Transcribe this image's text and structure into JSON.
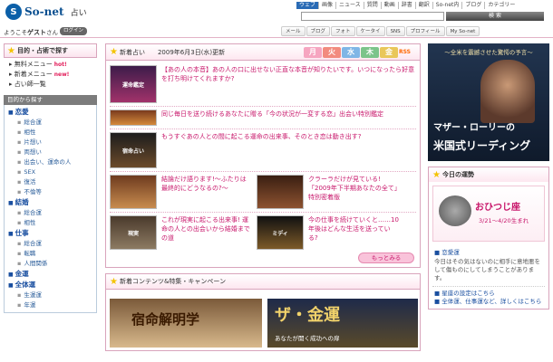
{
  "header": {
    "logo_mark": "S",
    "logo_name": "So-net",
    "logo_sub": "占い",
    "top_links": [
      "ウェブ",
      "画像",
      "ニュース",
      "質問",
      "動画",
      "辞書",
      "翻訳",
      "So-net内",
      "ブログ",
      "カテゴリー"
    ],
    "search_button": "検 索"
  },
  "userbar": {
    "welcome_prefix": "ようこそ",
    "welcome_guest": "ゲスト",
    "welcome_suffix": "さん",
    "login_label": "ログイン",
    "service_tabs": [
      "メール",
      "ブログ",
      "フォト",
      "ケータイ",
      "SNS",
      "プロフィール",
      "My So-net"
    ]
  },
  "sidebar": {
    "head_label": "目的・占術で探す",
    "menu": [
      {
        "label": "無料メニュー",
        "badge": "hot!"
      },
      {
        "label": "新着メニュー",
        "badge": "new!"
      },
      {
        "label": "占い師一覧",
        "badge": ""
      }
    ],
    "category_bar": "目的から探す",
    "groups": [
      {
        "title": "恋愛",
        "items": [
          "総合運",
          "相性",
          "片想い",
          "両想い",
          "出会い、運命の人",
          "SEX",
          "復活",
          "不倫等"
        ]
      },
      {
        "title": "結婚",
        "items": [
          "総合運",
          "相性"
        ]
      },
      {
        "title": "仕事",
        "items": [
          "総合運",
          "転職",
          "人間関係"
        ]
      },
      {
        "title": "金運",
        "items": []
      },
      {
        "title": "全体運",
        "items": [
          "生運運",
          "年運"
        ]
      }
    ]
  },
  "news": {
    "head_label": "新着占い",
    "date": "2009年6月3日(水)更新",
    "days": [
      "月",
      "火",
      "水",
      "木",
      "金"
    ],
    "rss": "RSS",
    "items": [
      {
        "thumb": "運命鑑定",
        "text": "【あの人の本音】あの人の口に出せない正直な本音が知りたいです。いつになったら好意を打ち明けてくれますか?"
      },
      {
        "thumb": "",
        "text": "同じ毎日を送り続けるあなたに贈る「今の状況が一変する恋」出会い特別鑑定"
      },
      {
        "thumb": "宿命占い",
        "text": "もうすぐあの人との間に起こる運命の出来事、そのとき恋は動き出す?"
      },
      {
        "thumb": "",
        "text": "結論だけ語ります!〜ふたりは最終的にどうなるの?〜"
      },
      {
        "thumb": "",
        "text": "クラーラだけが見ている!「2009年下半期あなたの全て」特別密着版"
      },
      {
        "thumb": "現実",
        "text": "これが現実に起こる出来事! 運命の人との出会いから結婚までの道"
      },
      {
        "thumb": "ミディ",
        "text": "今の仕事を続けていくと……10年後はどんな生活を送っている?"
      }
    ],
    "more_label": "もっとみる"
  },
  "contents": {
    "head_label": "新着コンテンツ&特集・キャンペーン",
    "banner1_text": "宿命解明学",
    "banner2_text": "ザ・金運",
    "banner2_sub": "あなたが開く成功への扉"
  },
  "right": {
    "ad_caption": "〜全米を震撼させた驚愕の予言〜",
    "ad_title1": "マザー・ローリーの",
    "ad_title2": "米国式リーディング",
    "fortune_head": "今日の運勢",
    "sign_name": "おひつじ座",
    "sign_date": "3/21〜4/20生まれ",
    "category": "恋愛運",
    "horoscope_text": "今日はその気はないのに相手に意地悪をして傷ものにしてしまうことがあります。",
    "links": [
      "星座の設定はこちら",
      "全体運、仕事運など、詳しくはこちら"
    ]
  },
  "colors": {
    "accent": "#c8176b",
    "link": "#1a4fa0",
    "pink_border": "#d9a4bc"
  }
}
